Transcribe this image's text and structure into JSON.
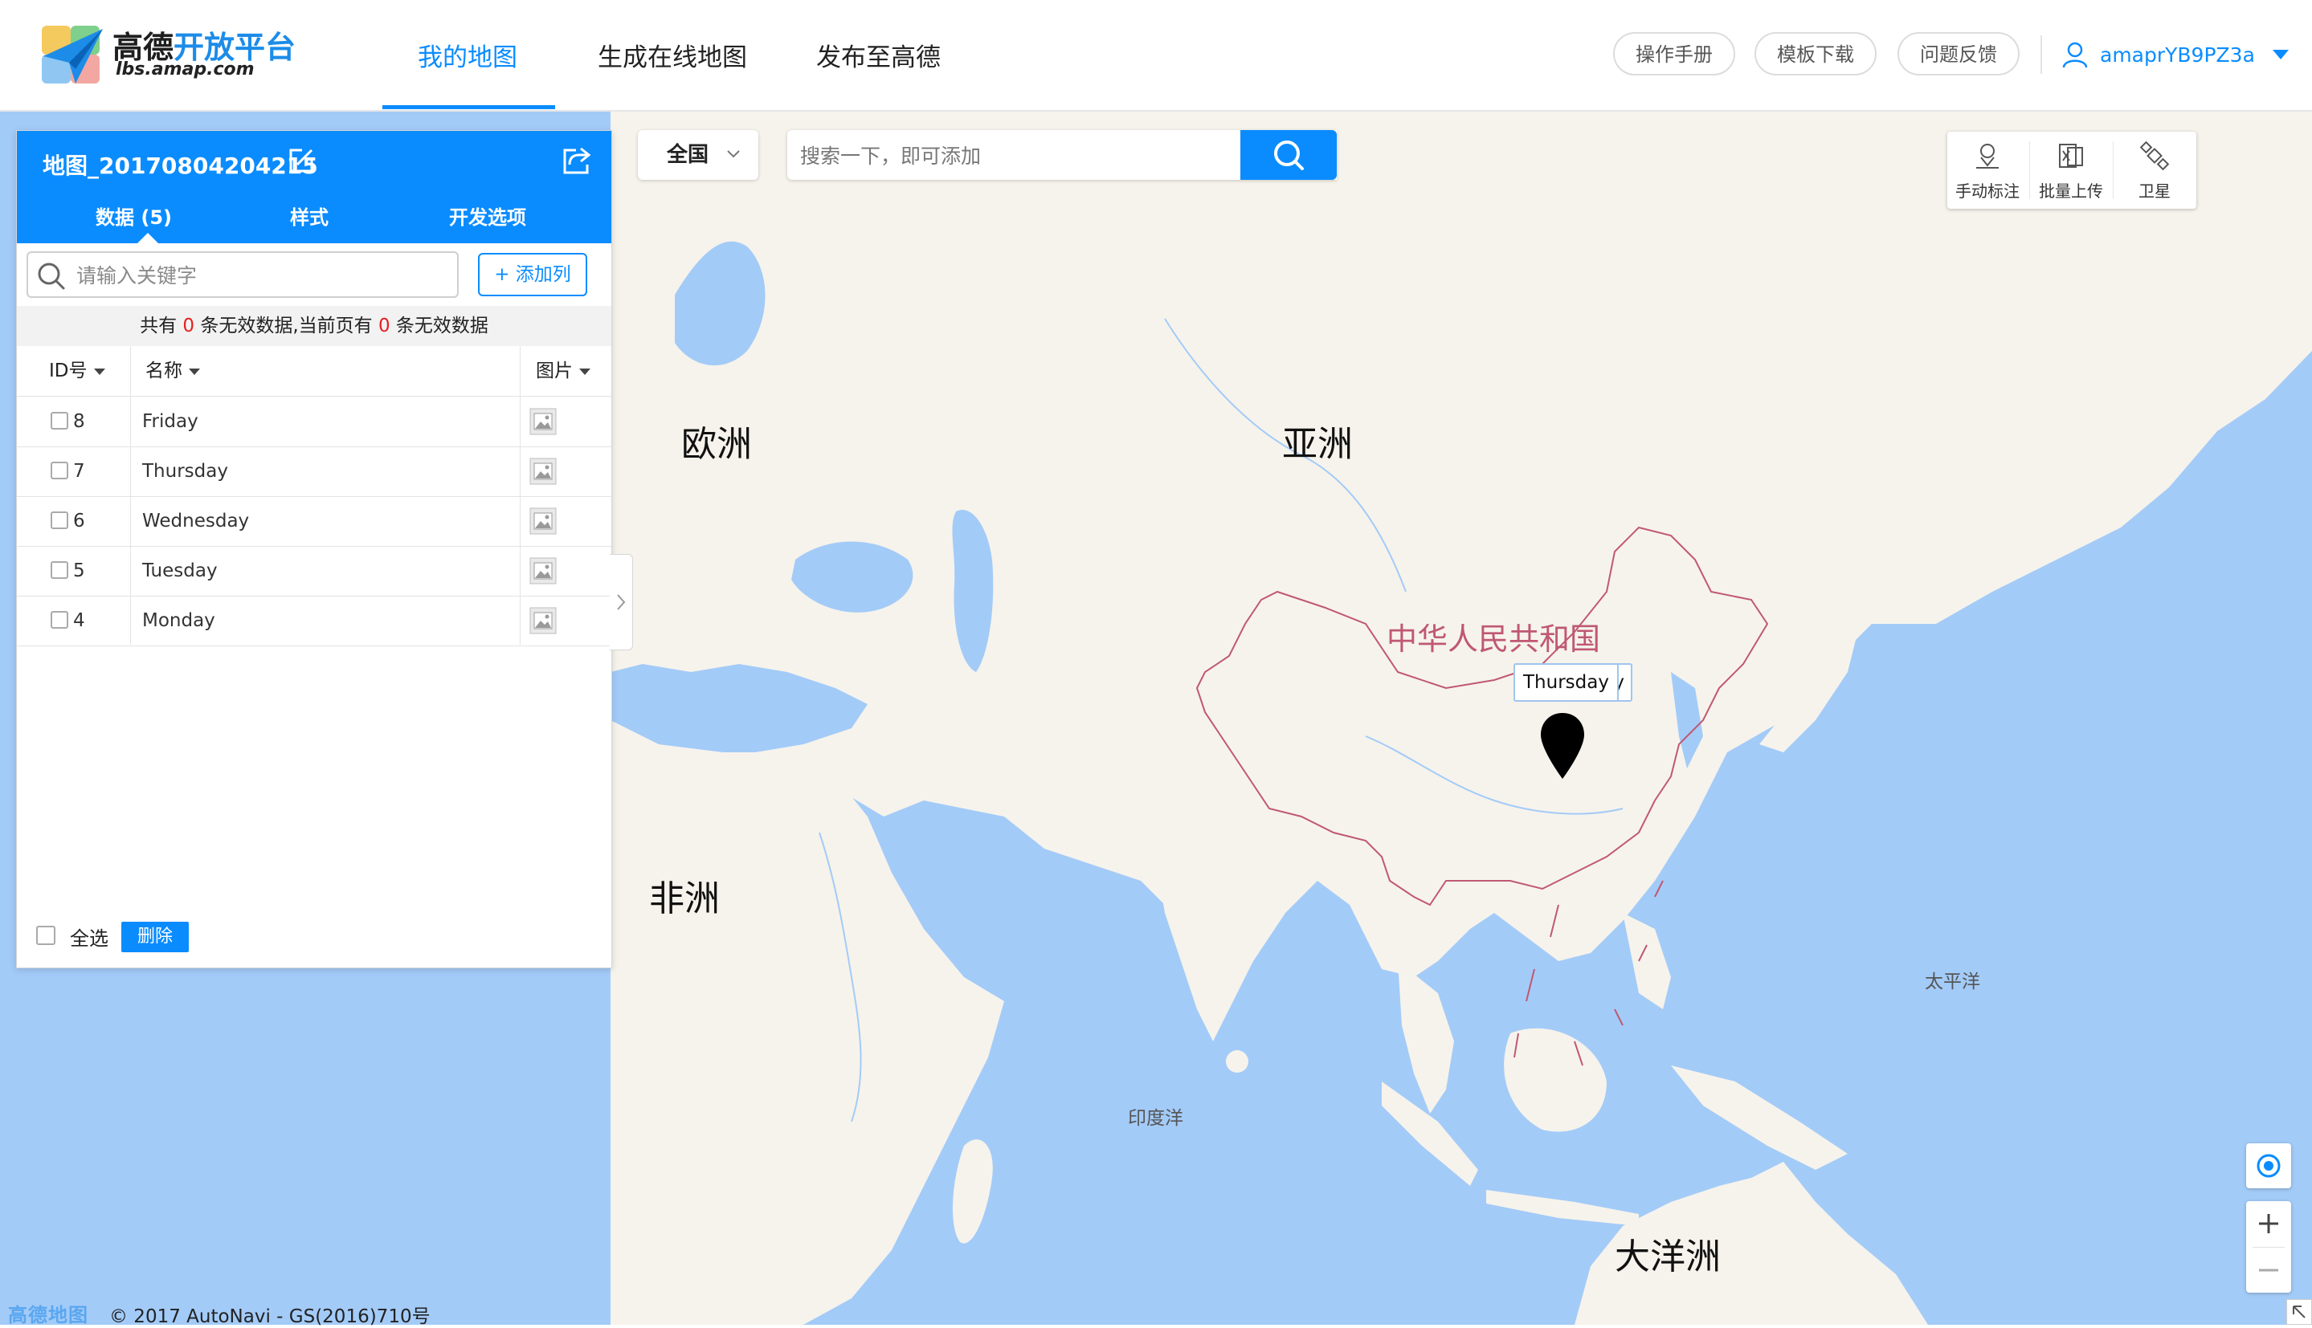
{
  "header": {
    "logo_cn_main": "高德",
    "logo_cn_accent": "开放平台",
    "logo_en": "lbs.amap.com",
    "nav": [
      "我的地图",
      "生成在线地图",
      "发布至高德"
    ],
    "buttons": [
      "操作手册",
      "模板下载",
      "问题反馈"
    ],
    "username": "amaprYB9PZ3a"
  },
  "panel": {
    "title": "地图_20170804204215",
    "tabs": [
      "数据 (5)",
      "样式",
      "开发选项"
    ],
    "search_placeholder": "请输入关键字",
    "add_column_label": "+ 添加列",
    "notice_prefix": "共有 ",
    "notice_count_total": "0",
    "notice_middle": " 条无效数据,当前页有 ",
    "notice_count_page": "0",
    "notice_suffix": " 条无效数据",
    "columns": [
      "ID号",
      "名称",
      "图片"
    ],
    "rows": [
      {
        "id": "8",
        "name": "Friday"
      },
      {
        "id": "7",
        "name": "Thursday"
      },
      {
        "id": "6",
        "name": "Wednesday"
      },
      {
        "id": "5",
        "name": "Tuesday"
      },
      {
        "id": "4",
        "name": "Monday"
      }
    ],
    "select_all_label": "全选",
    "delete_label": "删除"
  },
  "map_search": {
    "region": "全国",
    "placeholder": "搜索一下，即可添加"
  },
  "tools": [
    "手动标注",
    "批量上传",
    "卫星"
  ],
  "map_labels": {
    "europe": "欧洲",
    "asia": "亚洲",
    "africa": "非洲",
    "oceania": "大洋洲",
    "china": "中华人民共和国",
    "pacific": "太平洋",
    "indian_ocean": "印度洋"
  },
  "marker": {
    "label": "Thursday",
    "label_behind_tail": "y"
  },
  "attribution": {
    "logo": "高德地图",
    "text": "© 2017 AutoNavi - GS(2016)710号"
  },
  "colors": {
    "accent": "#0a8cff",
    "water": "#a3cbf8",
    "land": "#f6f3ec",
    "border": "#c05872",
    "invalid_count": "#e62020"
  },
  "icons": {
    "edit": "edit-icon",
    "share": "share-icon",
    "search": "search-icon",
    "image": "image-icon",
    "user": "user-icon",
    "marker": "map-pin-icon",
    "locate": "locate-icon"
  }
}
